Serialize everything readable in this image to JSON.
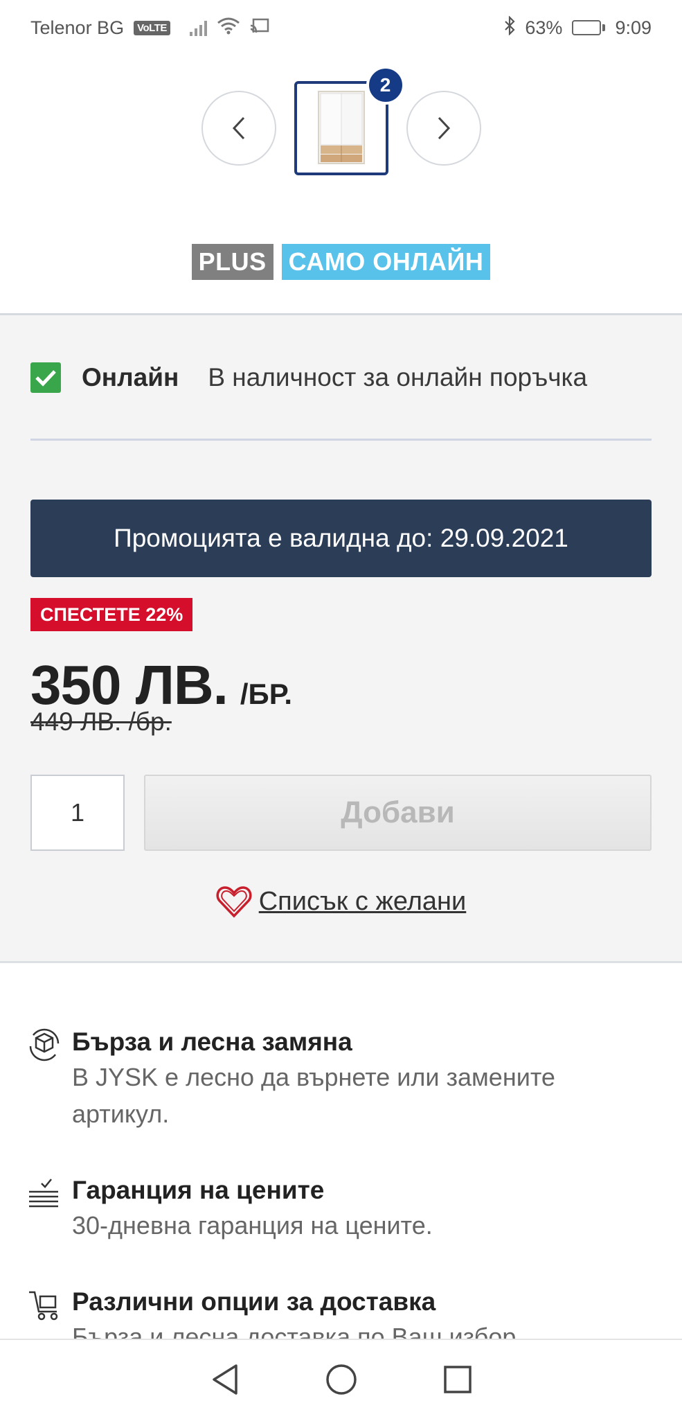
{
  "status_bar": {
    "carrier": "Telenor BG",
    "volte": "VoLTE",
    "battery": "63%",
    "time": "9:09",
    "battery_level": 0.63
  },
  "carousel": {
    "badge": "2"
  },
  "labels": {
    "plus": "PLUS",
    "online_only": "САМО ОНЛАЙН"
  },
  "availability": {
    "title": "Онлайн",
    "text": "В наличност за онлайн поръчка"
  },
  "promo": {
    "text": "Промоцията е валидна до: 29.09.2021"
  },
  "price": {
    "save_badge": "СПЕСТЕТЕ 22%",
    "current": "350 ЛВ.",
    "unit": "/БР.",
    "old": "449 ЛВ. /бр."
  },
  "cart": {
    "quantity": "1",
    "add_label": "Добави"
  },
  "wishlist": {
    "label": "Списък с желани"
  },
  "benefits": [
    {
      "title": "Бърза и лесна замяна",
      "text": "В JYSK е лесно да върнете или замените артикул.",
      "icon": "exchange-box-icon"
    },
    {
      "title": "Гаранция на цените",
      "text": "30-дневна гаранция на цените.",
      "icon": "price-guarantee-icon"
    },
    {
      "title": "Различни опции за доставка",
      "text": "Бърза и лесна доставка по Ваш избор.",
      "icon": "delivery-cart-icon"
    }
  ],
  "colors": {
    "promo_bg": "#2c3e57",
    "save_badge": "#d40e2b",
    "online_label": "#58c2ea",
    "plus_label": "#808080",
    "thumb_border": "#1e3a7a",
    "check": "#3aa64b",
    "wish_heart": "#c81f2d"
  }
}
